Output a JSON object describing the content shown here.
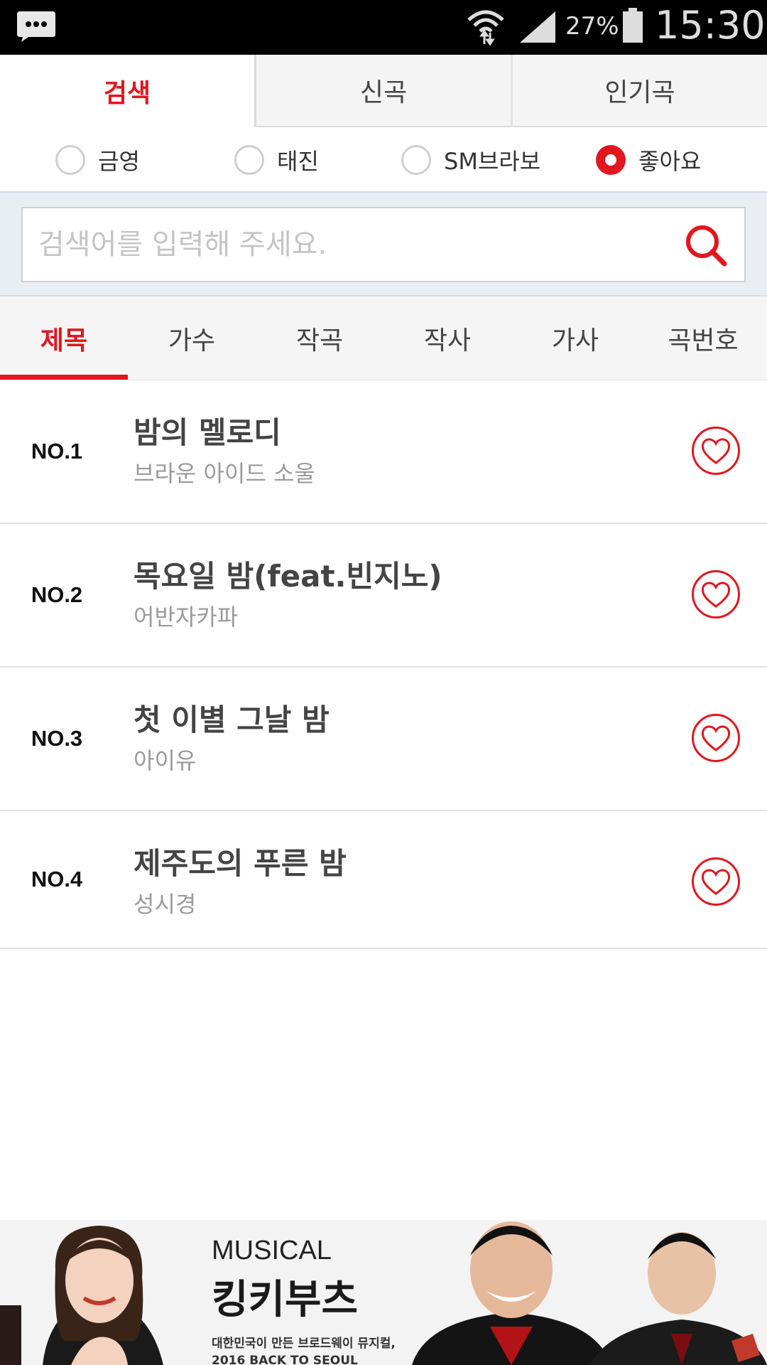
{
  "status_bar": {
    "battery_percent": "27%",
    "time": "15:30",
    "icons": [
      "message-icon",
      "wifi-icon",
      "signal-icon",
      "battery-icon"
    ]
  },
  "top_tabs": [
    {
      "label": "검색",
      "active": true
    },
    {
      "label": "신곡",
      "active": false
    },
    {
      "label": "인기곡",
      "active": false
    }
  ],
  "radio_options": [
    {
      "label": "금영",
      "checked": false
    },
    {
      "label": "태진",
      "checked": false
    },
    {
      "label": "SM브라보",
      "checked": false
    },
    {
      "label": "좋아요",
      "checked": true
    }
  ],
  "search": {
    "placeholder": "검색어를 입력해 주세요.",
    "value": ""
  },
  "filter_tabs": [
    {
      "label": "제목",
      "active": true
    },
    {
      "label": "가수",
      "active": false
    },
    {
      "label": "작곡",
      "active": false
    },
    {
      "label": "작사",
      "active": false
    },
    {
      "label": "가사",
      "active": false
    },
    {
      "label": "곡번호",
      "active": false
    }
  ],
  "songs": [
    {
      "rank": "NO.1",
      "title": "밤의 멜로디",
      "artist": "브라운 아이드 소울"
    },
    {
      "rank": "NO.2",
      "title": "목요일 밤(feat.빈지노)",
      "artist": "어반자카파"
    },
    {
      "rank": "NO.3",
      "title": "첫 이별 그날 밤",
      "artist": "아이유"
    },
    {
      "rank": "NO.4",
      "title": "제주도의 푸른 밤",
      "artist": "성시경"
    }
  ],
  "banner": {
    "subtitle": "MUSICAL",
    "title": "킹키부츠",
    "desc_line1": "대한민국이 만든 브로드웨이 뮤지컬,",
    "desc_line2": "2016 BACK TO SEOUL"
  },
  "colors": {
    "accent": "#e0171f",
    "search_bg": "#e9eef3",
    "tab_bg": "#f5f5f5"
  }
}
